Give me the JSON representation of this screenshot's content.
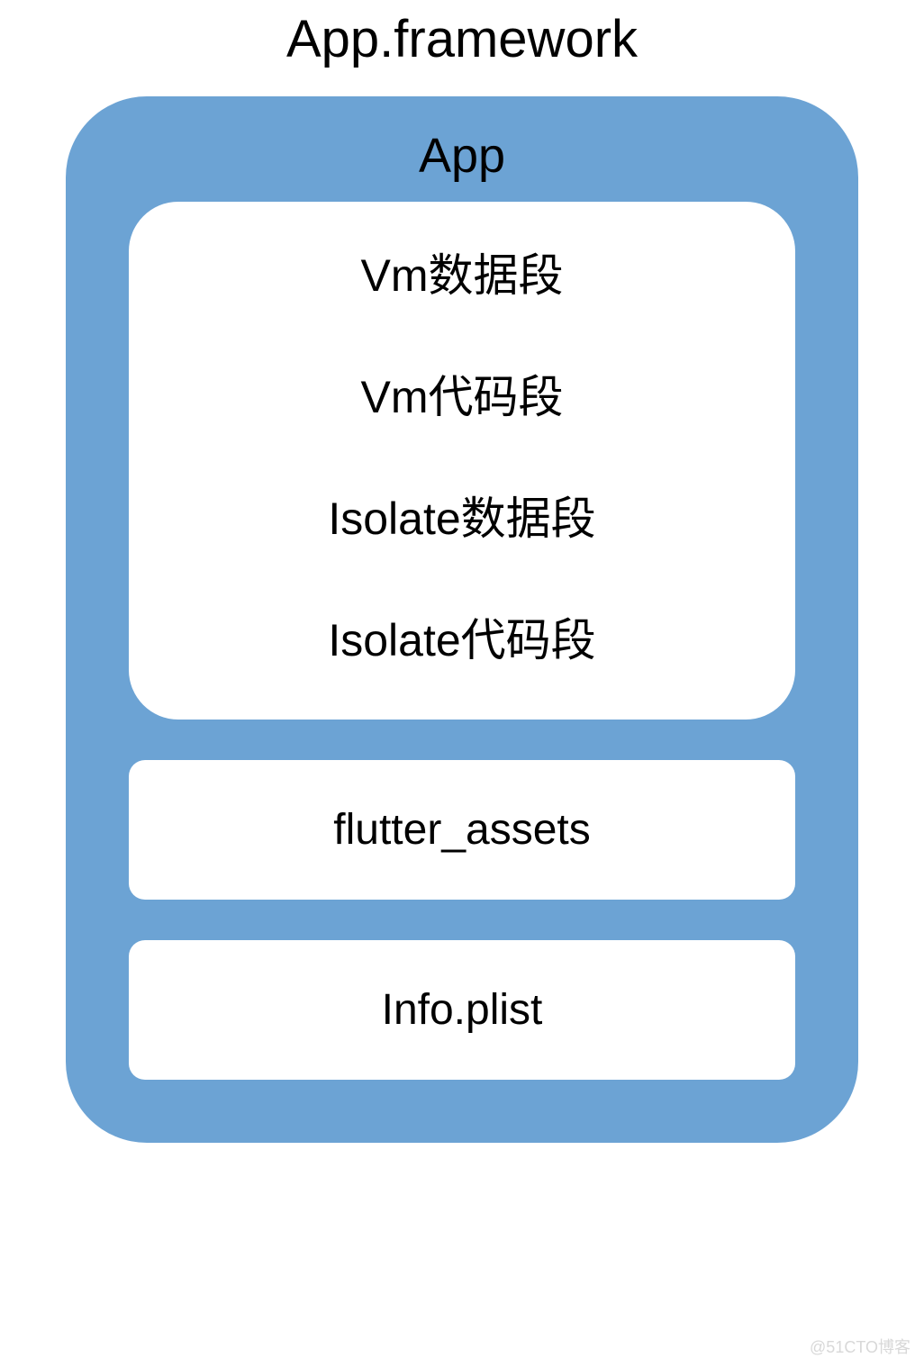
{
  "title": "App.framework",
  "container": {
    "section_title": "App",
    "app_items": [
      "Vm数据段",
      "Vm代码段",
      "Isolate数据段",
      "Isolate代码段"
    ],
    "boxes": [
      "flutter_assets",
      "Info.plist"
    ]
  },
  "watermark": "@51CTO博客"
}
